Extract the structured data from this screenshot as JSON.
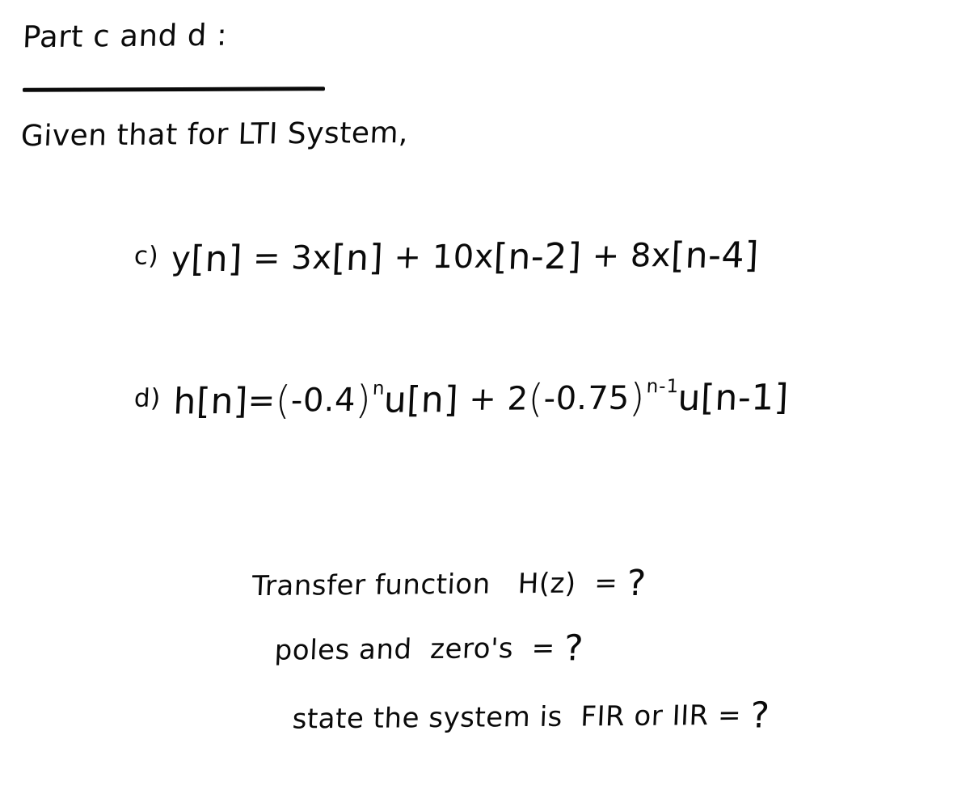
{
  "document": {
    "background_color": "#ffffff",
    "ink_color": "#0a0a0a",
    "medium": "handwritten-notes"
  },
  "title": {
    "text": "Part c and d :",
    "underlined": true
  },
  "intro": {
    "text": "Given that for LTI System,"
  },
  "equations": [
    {
      "label": "c)",
      "lhs": "y[n]",
      "eq": "=",
      "rhs_plain": "3x[n] + 10x[n-2] + 8x[n-4]",
      "tokens": [
        {
          "t": "y"
        },
        {
          "t": "[n]"
        },
        {
          "t": " = "
        },
        {
          "t": "3"
        },
        {
          "t": "x"
        },
        {
          "t": "[n]"
        },
        {
          "t": " + "
        },
        {
          "t": "10"
        },
        {
          "t": "x"
        },
        {
          "t": "[n-2]"
        },
        {
          "t": " + "
        },
        {
          "t": "8"
        },
        {
          "t": "x"
        },
        {
          "t": "[n-4]"
        }
      ]
    },
    {
      "label": "d)",
      "lhs": "h[n]",
      "eq": "=",
      "rhs_plain": "(-0.4)^n u[n] + 2(-0.75)^(n-1) u[n-1]",
      "base_1": "-0.4",
      "exponent_1": "n",
      "step_1": "u[n]",
      "coefficient_2": "2",
      "base_2": "-0.75",
      "exponent_2": "n-1",
      "step_2": "u[n-1]"
    }
  ],
  "questions": [
    {
      "text": "Transfer function   H(z)  = ",
      "mark": "?"
    },
    {
      "text": "poles and  zero's  = ",
      "mark": "?"
    },
    {
      "text": "state the system is  FIR or IIR = ",
      "mark": "?"
    }
  ]
}
